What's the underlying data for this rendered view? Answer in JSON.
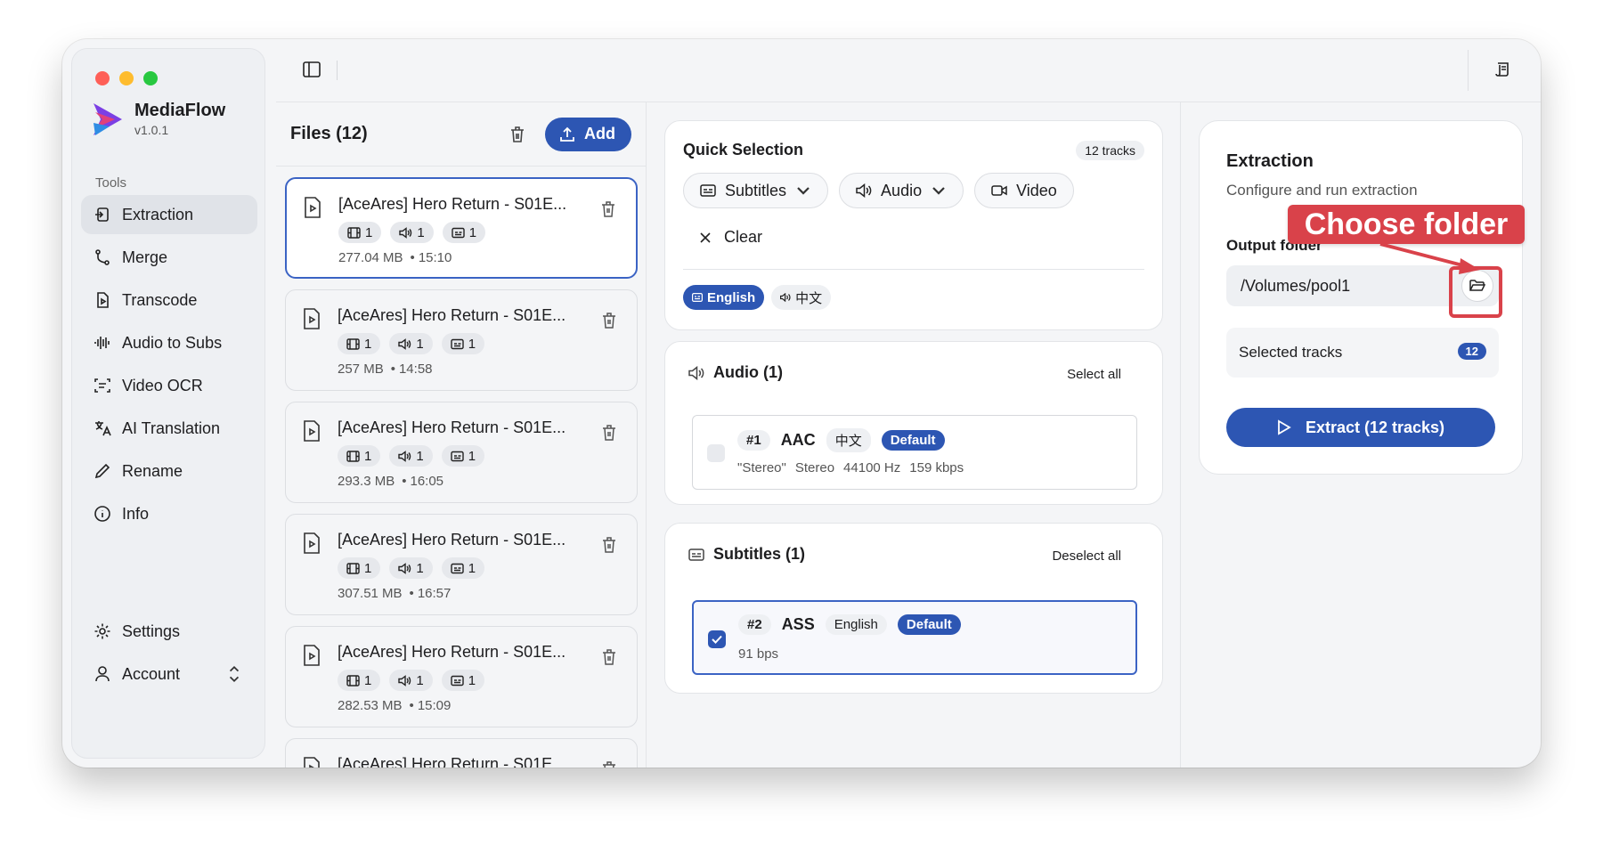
{
  "app": {
    "name": "MediaFlow",
    "version": "v1.0.1"
  },
  "sidebar": {
    "section_label": "Tools",
    "items": [
      {
        "label": "Extraction",
        "icon": "extraction-icon",
        "active": true
      },
      {
        "label": "Merge",
        "icon": "merge-icon"
      },
      {
        "label": "Transcode",
        "icon": "transcode-icon"
      },
      {
        "label": "Audio to Subs",
        "icon": "waveform-icon"
      },
      {
        "label": "Video OCR",
        "icon": "ocr-scan-icon"
      },
      {
        "label": "AI Translation",
        "icon": "translate-icon"
      },
      {
        "label": "Rename",
        "icon": "pencil-icon"
      },
      {
        "label": "Info",
        "icon": "info-icon"
      }
    ],
    "bottom": [
      {
        "label": "Settings",
        "icon": "gear-icon"
      },
      {
        "label": "Account",
        "icon": "user-icon"
      }
    ]
  },
  "files": {
    "title": "Files (12)",
    "add_label": "Add",
    "items": [
      {
        "name": "[AceAres] Hero Return - S01E...",
        "video": "1",
        "audio": "1",
        "subs": "1",
        "size": "277.04 MB",
        "duration": "15:10"
      },
      {
        "name": "[AceAres] Hero Return - S01E...",
        "video": "1",
        "audio": "1",
        "subs": "1",
        "size": "257 MB",
        "duration": "14:58"
      },
      {
        "name": "[AceAres] Hero Return - S01E...",
        "video": "1",
        "audio": "1",
        "subs": "1",
        "size": "293.3 MB",
        "duration": "16:05"
      },
      {
        "name": "[AceAres] Hero Return - S01E...",
        "video": "1",
        "audio": "1",
        "subs": "1",
        "size": "307.51 MB",
        "duration": "16:57"
      },
      {
        "name": "[AceAres] Hero Return - S01E...",
        "video": "1",
        "audio": "1",
        "subs": "1",
        "size": "282.53 MB",
        "duration": "15:09"
      },
      {
        "name": "[AceAres] Hero Return - S01E..."
      }
    ]
  },
  "quick_selection": {
    "title": "Quick Selection",
    "count": "12 tracks",
    "pills": [
      "Subtitles",
      "Audio",
      "Video"
    ],
    "clear_label": "Clear",
    "langs": [
      "English",
      "中文"
    ]
  },
  "audio_section": {
    "title": "Audio (1)",
    "action": "Select all",
    "track": {
      "num": "#1",
      "codec": "AAC",
      "lang": "中文",
      "default": "Default",
      "meta": [
        "\"Stereo\"",
        "Stereo",
        "44100 Hz",
        "159 kbps"
      ]
    }
  },
  "subs_section": {
    "title": "Subtitles (1)",
    "action": "Deselect all",
    "track": {
      "num": "#2",
      "codec": "ASS",
      "lang": "English",
      "default": "Default",
      "meta": [
        "91 bps"
      ]
    }
  },
  "extraction": {
    "title": "Extraction",
    "subtitle": "Configure and run extraction",
    "output_label": "Output folder",
    "output_value": "/Volumes/pool1",
    "selected_label": "Selected tracks",
    "selected_count": "12",
    "extract_label": "Extract (12 tracks)"
  },
  "annotation": {
    "label": "Choose folder",
    "color": "#d9424a"
  },
  "colors": {
    "accent": "#2d56b3",
    "window_bg": "#f4f5f7"
  }
}
